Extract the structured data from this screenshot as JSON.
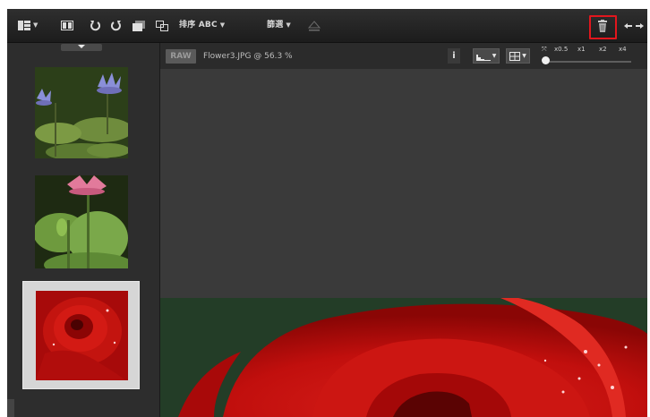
{
  "toolbar": {
    "sort_label": "排序 ABC",
    "filter_label": "篩選",
    "icons": [
      "layout-icon",
      "compare-icon",
      "rotate-left-icon",
      "rotate-right-icon",
      "stack-icon",
      "link-icon",
      "trash-icon",
      "arrows-icon"
    ]
  },
  "viewer": {
    "badge": "RAW",
    "file_label": "Flower3.JPG @ 56.3 %",
    "info_label": "i",
    "zoom_levels": [
      "x0.5",
      "x1",
      "x2",
      "x4"
    ],
    "zoom_value": 0
  },
  "filmstrip": {
    "items": [
      {
        "name": "water-lily-thumbnail",
        "selected": false
      },
      {
        "name": "lotus-thumbnail",
        "selected": false
      },
      {
        "name": "rose-thumbnail",
        "selected": true
      }
    ]
  },
  "colors": {
    "highlight": "#e2161d",
    "panel": "#2b2b2b",
    "canvas": "#3a3a3a"
  }
}
